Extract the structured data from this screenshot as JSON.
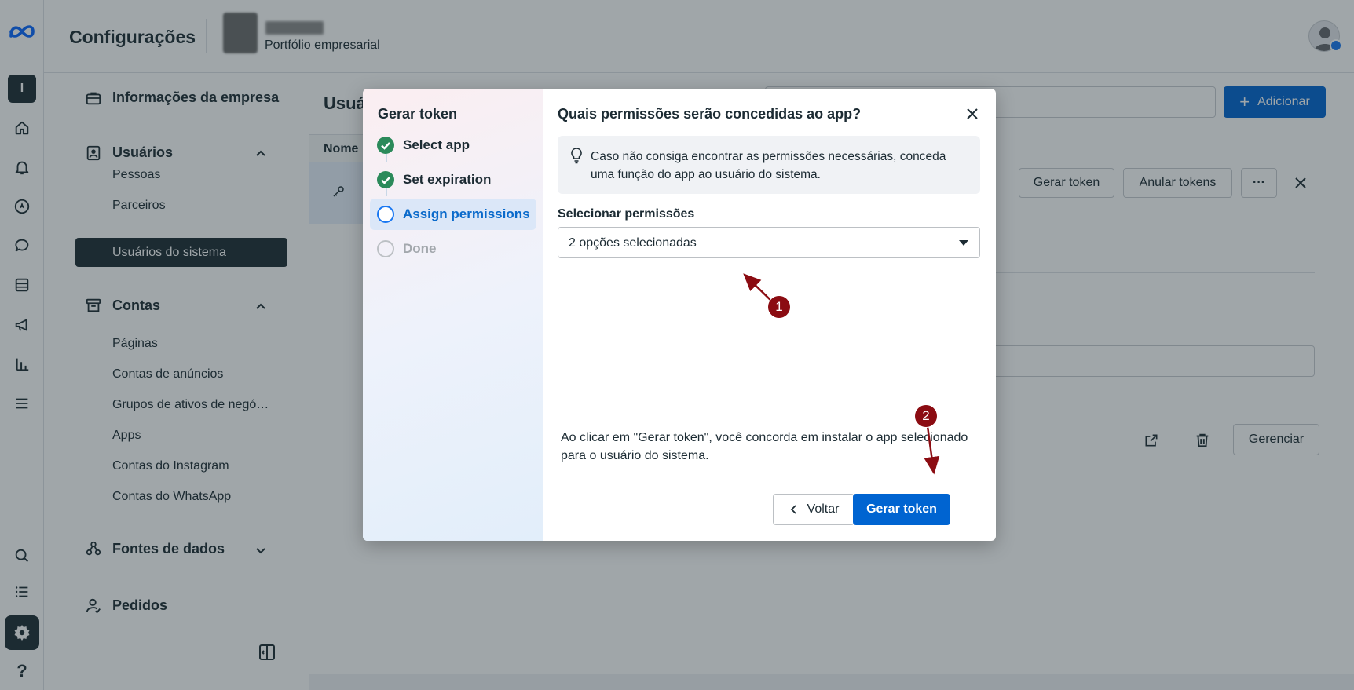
{
  "header": {
    "title": "Configurações",
    "business_subtitle": "Portfólio empresarial"
  },
  "rail": {
    "account_initial": "I",
    "help_glyph": "?"
  },
  "sidenav": {
    "company_info": "Informações da empresa",
    "users": {
      "label": "Usuários",
      "items": [
        "Pessoas",
        "Parceiros",
        "Usuários do sistema"
      ]
    },
    "accounts": {
      "label": "Contas",
      "items": [
        "Páginas",
        "Contas de anúncios",
        "Grupos de ativos de negó…",
        "Apps",
        "Contas do Instagram",
        "Contas do WhatsApp"
      ]
    },
    "data_sources": "Fontes de dados",
    "orders": "Pedidos"
  },
  "main": {
    "panel_title": "Usuá",
    "column_name": "Nome",
    "add_button": "Adicionar",
    "gerar_token_button": "Gerar token",
    "anular_tokens_button": "Anular tokens",
    "more_button": "···",
    "gerenciar_button": "Gerenciar"
  },
  "modal": {
    "steps_title": "Gerar token",
    "steps": [
      {
        "label": "Select app",
        "state": "done"
      },
      {
        "label": "Set expiration",
        "state": "done"
      },
      {
        "label": "Assign permissions",
        "state": "current"
      },
      {
        "label": "Done",
        "state": "todo"
      }
    ],
    "question": "Quais permissões serão concedidas ao app?",
    "info_text": "Caso não consiga encontrar as permissões necessárias, conceda uma função do app ao usuário do sistema.",
    "select_label": "Selecionar permissões",
    "select_value": "2 opções selecionadas",
    "agreement": "Ao clicar em \"Gerar token\", você concorda em instalar o app selecionado para o usuário do sistema.",
    "back_button": "Voltar",
    "generate_button": "Gerar token"
  },
  "annotations": {
    "badge_1": "1",
    "badge_2": "2",
    "color": "#8b0c12"
  },
  "colors": {
    "primary": "#0064d1",
    "step_done": "#2b8a5a",
    "step_current": "#1877f2"
  }
}
